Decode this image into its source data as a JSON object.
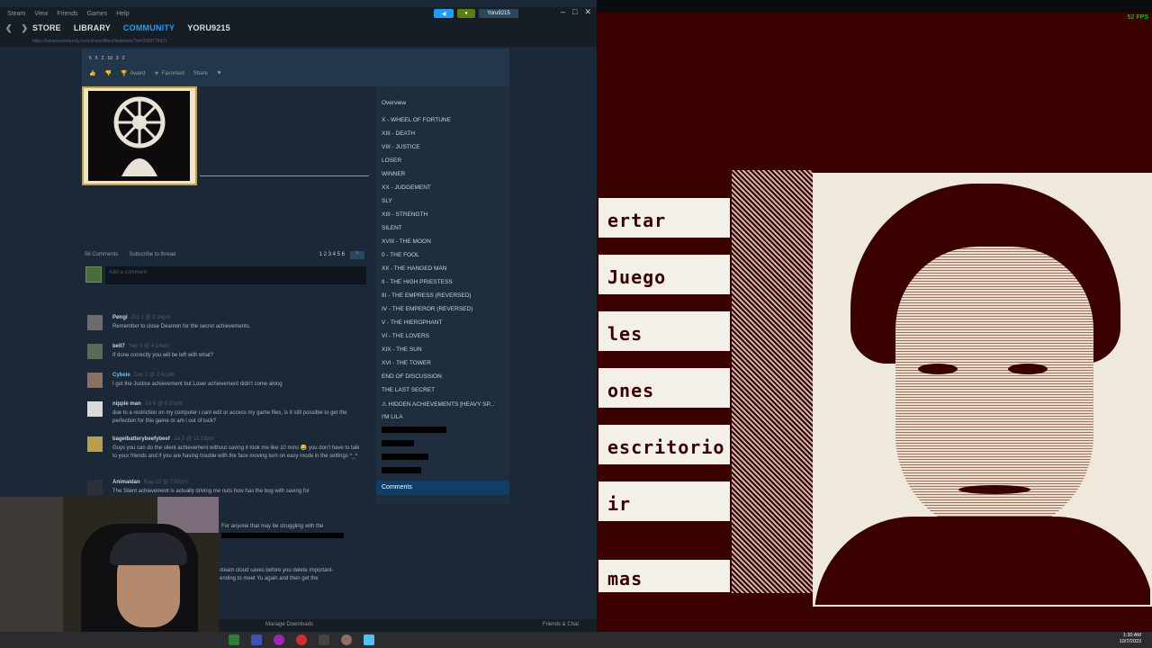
{
  "steam": {
    "menu": [
      "Steam",
      "View",
      "Friends",
      "Games",
      "Help"
    ],
    "nav": {
      "store": "STORE",
      "library": "LIBRARY",
      "community": "COMMUNITY",
      "user": "YORU9215"
    },
    "account_name": "Yoru9215",
    "url": "https://steamcommunity.com/sharedfiles/filedetails/?id=3099776621",
    "header": {
      "ratings": [
        "6",
        "5",
        "2",
        "10",
        "3",
        "2"
      ],
      "award": "Award",
      "favorited": "Favorited",
      "share": "Share"
    },
    "comments_count": "56 Comments",
    "subscribe": "Subscribe to thread",
    "pages": "1 2 3 4 5 6",
    "add_comment": "Add a comment",
    "comments": [
      {
        "name": "Pøngi",
        "date": "Oct 1 @ 2:24pm",
        "text": "Remember to close Deamon for the secret achievements."
      },
      {
        "name": "bell7",
        "date": "Sep 9 @ 4:14am",
        "text": "If done correctly you will be left with what?"
      },
      {
        "name": "Cybele",
        "date": "Sep 2 @ 2:41pm",
        "text": "I got the Justice achievement but Loser achievement didn't come along"
      },
      {
        "name": "nipple man",
        "date": "Jul 9 @ 6:15pm",
        "text": "due to a restriction on my computer i cant edit or access my game files, is it still possible to get the perfection for this game or am i out of luck?"
      },
      {
        "name": "bagelbatterybeefybeef",
        "date": "Jul 2 @ 11:13pm",
        "text": "Guys you can do the silent achievement without saving it took me like 10 mins 😂 you don't have to talk to your friends and if you are having trouble with the face moving turn on easy mode in the settings ^_^"
      },
      {
        "name": "Animaidan",
        "date": "May 22 @ 7:50pm",
        "text": "The Silent achievement is actually driving me nuts how has the bug with saving for"
      }
    ],
    "partial_texts": [
      "For anyone that may be struggling with the",
      "steam cloud saves before you delete important-",
      "ending to meet Yu again and then get the"
    ],
    "guide_nav": [
      "Overview",
      "X - WHEEL OF FORTUNE",
      "XIII - DEATH",
      "VIII - JUSTICE",
      "LOSER",
      "WINNER",
      "XX - JUDGEMENT",
      "SLY",
      "XIII - STRENGTH",
      "SILENT",
      "XVIII - THE MOON",
      "0 - THE FOOL",
      "XII - THE HANGED MAN",
      "II - THE HIGH PRIESTESS",
      "III - THE EMPRESS (REVERSED)",
      "IV - THE EMPEROR (REVERSED)",
      "V - THE HIEROPHANT",
      "VI - THE LOVERS",
      "XIX - THE SUN",
      "XVI - THE TOWER",
      "END OF DISCUSSION",
      "THE LAST SECRET",
      "⚠ HIDDEN ACHIEVEMENTS [HEAVY SP...",
      "I'M LILA"
    ],
    "guide_comments": "Comments",
    "manage_downloads": "Manage Downloads",
    "friends_chat": "Friends & Chat"
  },
  "game": {
    "fps": "52 FPS",
    "buttons": [
      "ertar",
      "Juego",
      "les",
      "ones",
      "escritorio",
      "ir",
      "mas"
    ]
  },
  "taskbar": {
    "time": "1:30 AM",
    "date": "10/7/2023"
  },
  "colors": {
    "steam_bg": "#1b2838",
    "steam_accent": "#1a9fff",
    "game_dark": "#3a0000",
    "game_light": "#f3f0e8"
  }
}
